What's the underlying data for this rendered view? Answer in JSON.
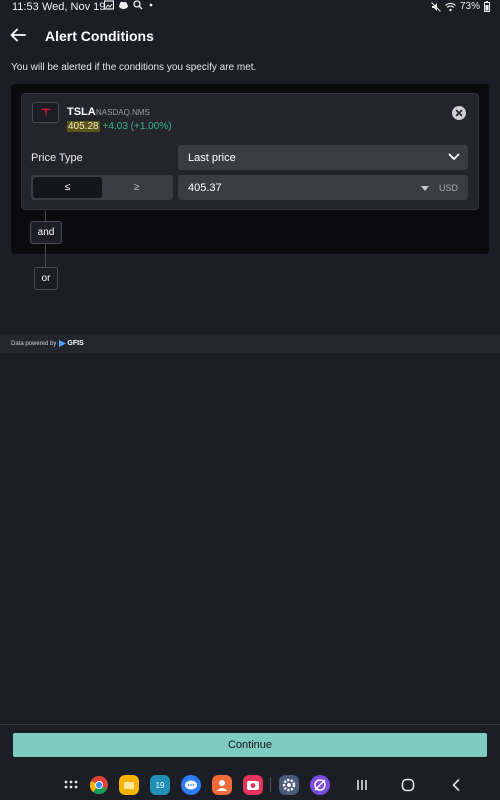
{
  "status_bar": {
    "time": "11:53",
    "date": "Wed, Nov 19",
    "battery": "73%"
  },
  "header": {
    "title": "Alert Conditions"
  },
  "subtitle": "You will be alerted if the conditions you specify are met.",
  "stock": {
    "ticker": "TSLA",
    "exchange": "NASDAQ.NMS",
    "price": "405.28",
    "change": "+4.03 (+1.00%)"
  },
  "condition": {
    "label": "Price Type",
    "price_type_value": "Last price",
    "operator_options": [
      "≤",
      "≥"
    ],
    "selected_operator": "≤",
    "value": "405.37",
    "currency": "USD"
  },
  "logic": {
    "and_label": "and",
    "or_label": "or"
  },
  "footer": {
    "powered_by": "Data powered by",
    "provider": "GFIS",
    "continue_label": "Continue"
  },
  "dock": {
    "calendar_day": "19",
    "apps": [
      "apps-grid-icon",
      "chrome-icon",
      "files-icon",
      "calendar-icon",
      "messages-icon",
      "contacts-icon",
      "screen-recorder-icon",
      "settings-icon",
      "browser-icon"
    ]
  },
  "colors": {
    "background": "#1c1e26",
    "accent": "#7ecbbf",
    "positive": "#35b58a",
    "tesla_red": "#e31937"
  }
}
